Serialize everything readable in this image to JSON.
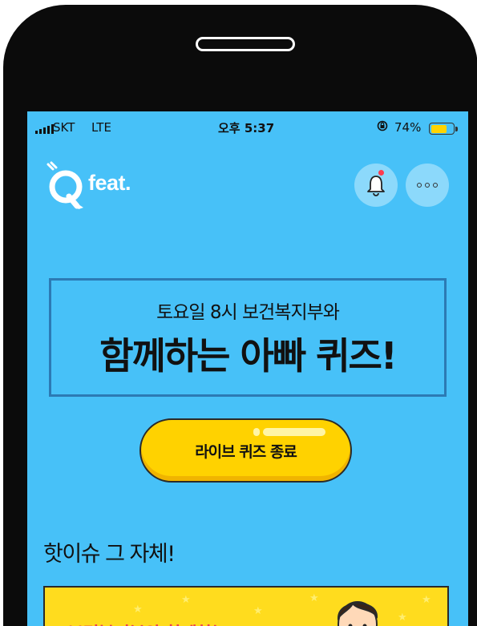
{
  "status_bar": {
    "carrier": "SKT",
    "network": "LTE",
    "time": "오후 5:37",
    "battery_percent": "74%",
    "battery_level": 0.74
  },
  "header": {
    "logo_text": "feat.",
    "bell_icon": "bell-icon",
    "more_icon": "more-icon"
  },
  "banner": {
    "subtitle": "토요일 8시 보건복지부와",
    "title": "함께하는 아빠 퀴즈!"
  },
  "live_button": {
    "label": "라이브 퀴즈 종료"
  },
  "section": {
    "title": "핫이슈 그 자체!"
  },
  "card": {
    "text": "보건복지부와 함께하는"
  },
  "colors": {
    "screen_bg": "#47c1f8",
    "button_yellow": "#ffd200",
    "card_yellow": "#ffdc1e",
    "card_text": "#ee3a54"
  }
}
